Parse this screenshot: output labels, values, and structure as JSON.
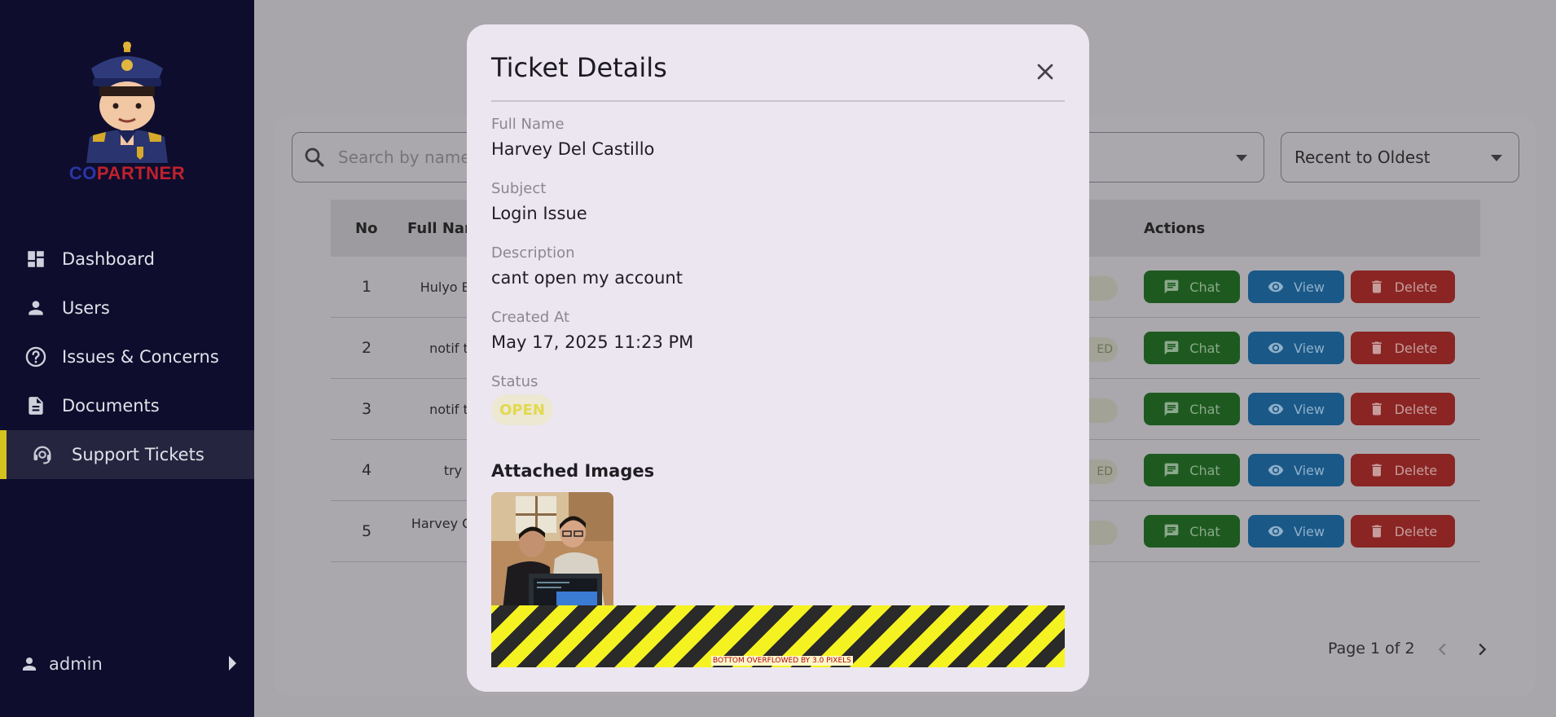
{
  "brand": {
    "co": "CO",
    "partner": "PARTNER"
  },
  "sidebar": {
    "items": [
      {
        "label": "Dashboard",
        "icon": "dashboard-icon"
      },
      {
        "label": "Users",
        "icon": "person-icon"
      },
      {
        "label": "Issues & Concerns",
        "icon": "help-circle-icon"
      },
      {
        "label": "Documents",
        "icon": "document-icon"
      },
      {
        "label": "Support Tickets",
        "icon": "support-agent-icon",
        "active": true
      }
    ],
    "user": "admin"
  },
  "toolbar": {
    "search_placeholder": "Search by name",
    "sort_value": "Recent to Oldest"
  },
  "table": {
    "headers": {
      "no": "No",
      "full_name": "Full Name",
      "actions": "Actions"
    },
    "rows": [
      {
        "no": "1",
        "name": "Hulyo Bac",
        "badge": ""
      },
      {
        "no": "2",
        "name": "notif tu",
        "badge": "ED"
      },
      {
        "no": "3",
        "name": "notif tu",
        "badge": ""
      },
      {
        "no": "4",
        "name": "try",
        "badge": "ED"
      },
      {
        "no": "5",
        "name": "Harvey Casti",
        "badge": ""
      }
    ],
    "actions": {
      "chat": "Chat",
      "view": "View",
      "delete": "Delete"
    }
  },
  "pagination": {
    "label": "Page 1 of 2"
  },
  "modal": {
    "title": "Ticket Details",
    "fields": {
      "full_name_label": "Full Name",
      "full_name": "Harvey Del Castillo",
      "subject_label": "Subject",
      "subject": "Login Issue",
      "description_label": "Description",
      "description": "cant open my account",
      "created_label": "Created At",
      "created": "May 17, 2025 11:23 PM",
      "status_label": "Status",
      "status": "OPEN"
    },
    "attached_title": "Attached Images",
    "overflow_message": "BOTTOM OVERFLOWED BY 3.0 PIXELS"
  },
  "colors": {
    "sidebar_bg": "#0e0d2d",
    "accent_yellow": "#d4c21f",
    "chat_green": "#2e7d32",
    "view_blue": "#1976d2",
    "delete_red": "#d32f2f",
    "status_open": "#e3d94e"
  }
}
